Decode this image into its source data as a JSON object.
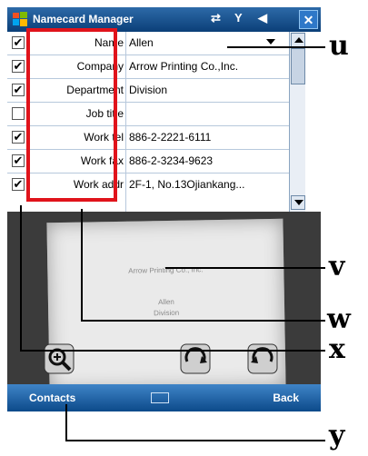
{
  "titlebar": {
    "title": "Namecard Manager",
    "icons": [
      "windows-logo-icon",
      "sync-icon",
      "signal-icon",
      "volume-icon"
    ],
    "close_glyph": "✕"
  },
  "fields": [
    {
      "checked": true,
      "label": "Name",
      "value": "Allen"
    },
    {
      "checked": true,
      "label": "Company",
      "value": "Arrow Printing Co.,Inc."
    },
    {
      "checked": true,
      "label": "Department",
      "value": "Division"
    },
    {
      "checked": false,
      "label": "Job title",
      "value": ""
    },
    {
      "checked": true,
      "label": "Work tel",
      "value": "886-2-2221-6111"
    },
    {
      "checked": true,
      "label": "Work fax",
      "value": "886-2-3234-9623"
    },
    {
      "checked": true,
      "label": "Work addr",
      "value": "2F-1, No.13Ojiankang..."
    }
  ],
  "highlight_color": "#e0131b",
  "card_text": {
    "company": "Arrow Printing Co., Inc.",
    "person": "Allen",
    "role": "Division"
  },
  "menubar": {
    "left": "Contacts",
    "right": "Back"
  },
  "callouts": [
    "u",
    "v",
    "w",
    "x",
    "y"
  ],
  "colors": {
    "titlebar": "#0b3f78",
    "menubar": "#0c4a8a",
    "highlight": "#e0131b"
  }
}
